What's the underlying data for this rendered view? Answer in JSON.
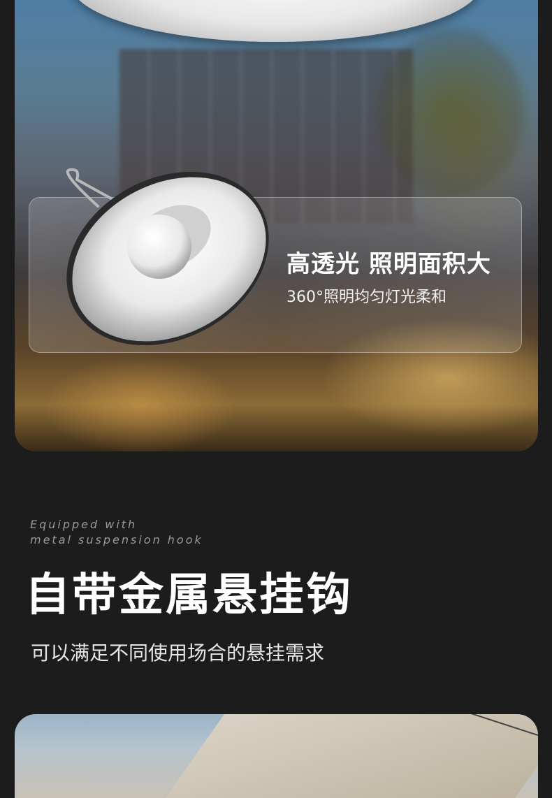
{
  "feature_card": {
    "title": "高透光 照明面积大",
    "subtitle": "360°照明均匀灯光柔和"
  },
  "section": {
    "en_line1": "Equipped with",
    "en_line2": "metal suspension hook",
    "title": "自带金属悬挂钩",
    "description": "可以满足不同使用场合的悬挂需求"
  }
}
